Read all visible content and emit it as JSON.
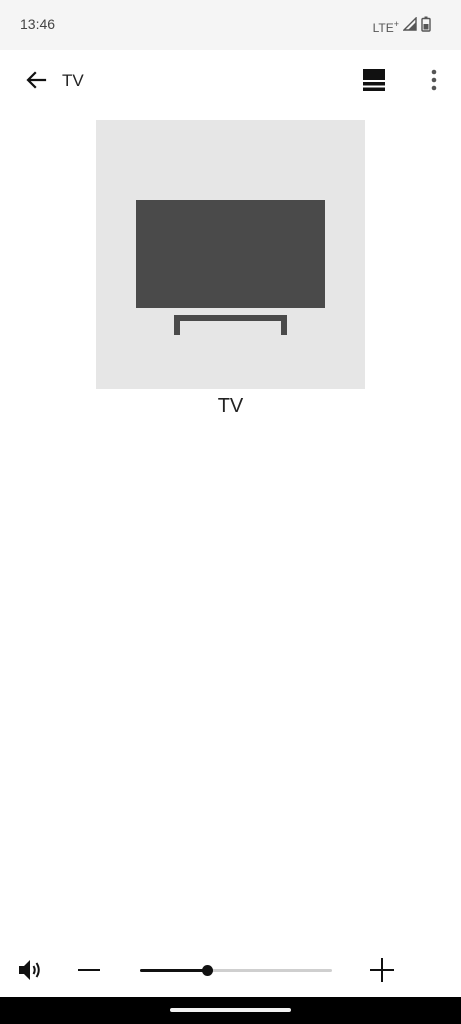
{
  "status_bar": {
    "time": "13:46",
    "network": "LTE",
    "network_suffix": "+",
    "icons": [
      "signal-icon",
      "battery-icon"
    ]
  },
  "app_bar": {
    "title": "TV",
    "icons": [
      "back-arrow-icon",
      "layout-toggle-icon",
      "more-vert-icon"
    ]
  },
  "device": {
    "name": "TV",
    "icon": "tv-icon",
    "tile_color": "#e6e6e6",
    "icon_color": "#4a4a4a"
  },
  "volume": {
    "level_fraction": 0.35,
    "icons": [
      "speaker-icon",
      "minus-icon",
      "plus-icon"
    ]
  },
  "colors": {
    "accent": "#111111",
    "track": "#cfcfcf",
    "status_bar_bg": "#f5f5f5"
  }
}
